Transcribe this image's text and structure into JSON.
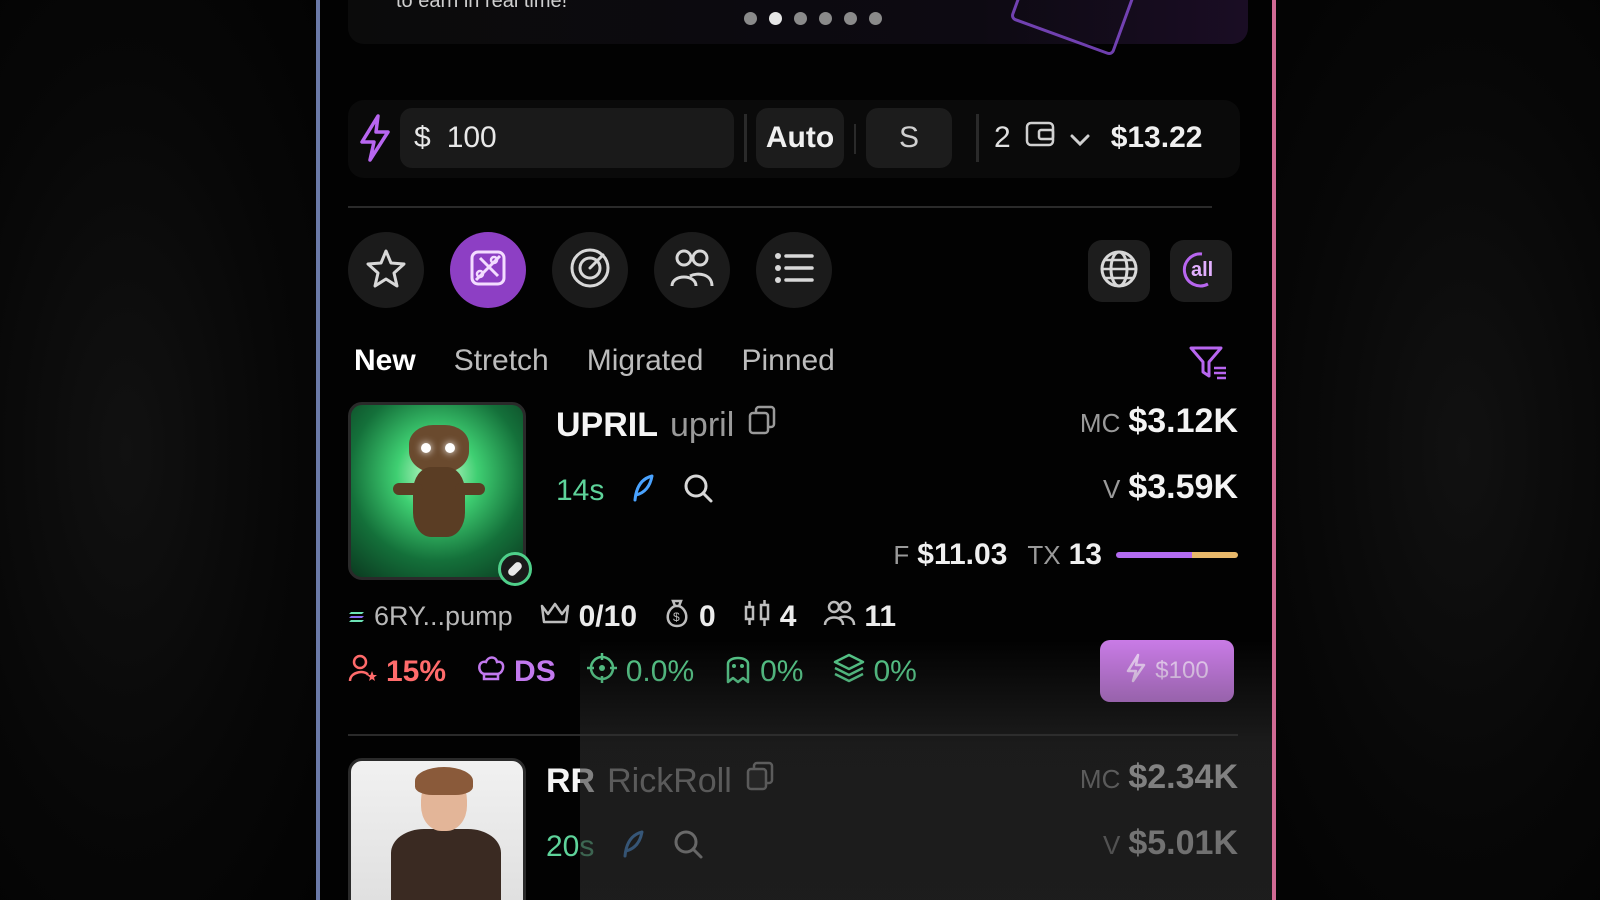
{
  "banner": {
    "text": "to earn in real time!",
    "dots_count": 6,
    "active_dot": 1
  },
  "buybar": {
    "currency": "$",
    "amount": "100",
    "mode_button": "Auto",
    "speed_button": "S",
    "wallet_count": "2",
    "balance": "$13.22"
  },
  "icons": {
    "row": [
      "star-icon",
      "scissors-percent-icon",
      "radar-icon",
      "users-icon",
      "list-icon"
    ],
    "right": [
      "globe-icon",
      "all-filter-icon"
    ],
    "all_label": "all"
  },
  "tabs": [
    {
      "label": "New",
      "active": true
    },
    {
      "label": "Stretch",
      "active": false
    },
    {
      "label": "Migrated",
      "active": false
    },
    {
      "label": "Pinned",
      "active": false
    }
  ],
  "tokens": [
    {
      "ticker": "UPRIL",
      "name": "upril",
      "age": "14s",
      "mc_label": "MC",
      "mc": "$3.12K",
      "vol_label": "V",
      "vol": "$3.59K",
      "fee_label": "F",
      "fee": "$11.03",
      "tx_label": "TX",
      "tx": "13",
      "tx_buy_ratio": 0.62,
      "address": "6RY...pump",
      "top_holders": "0/10",
      "dev_holdings": "0",
      "candles": "4",
      "holders": "11",
      "top10_pct": "15%",
      "ds_label": "DS",
      "sniper_pct": "0.0%",
      "insider_pct": "0%",
      "bundle_pct": "0%",
      "buy_label": "$100"
    },
    {
      "ticker": "RR",
      "name": "RickRoll",
      "age": "20s",
      "mc_label": "MC",
      "mc": "$2.34K",
      "vol_label": "V",
      "vol": "$5.01K"
    }
  ],
  "colors": {
    "accent_purple": "#8d3fc4",
    "age_green": "#5ed39a",
    "buy_button": "#c97be6",
    "tx_buy": "#b36bf0",
    "tx_sell": "#e8b86a"
  }
}
